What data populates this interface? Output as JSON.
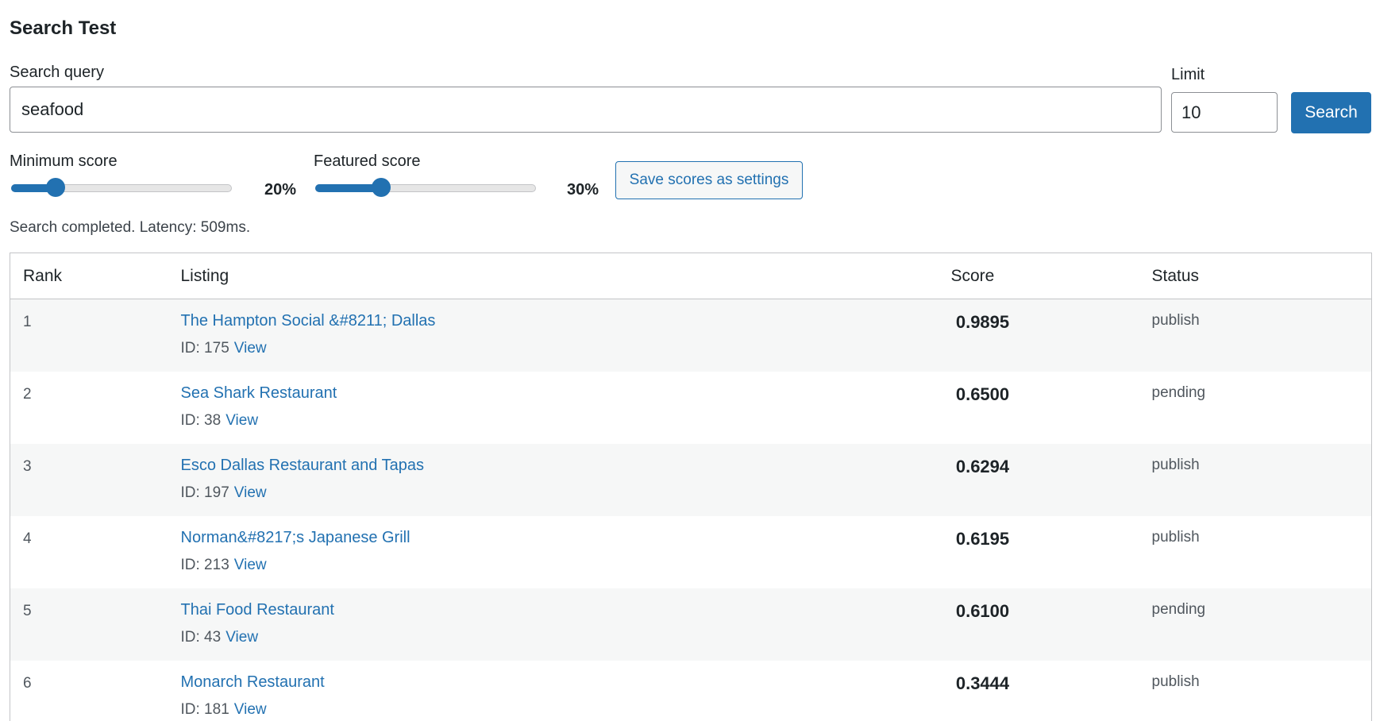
{
  "page": {
    "title": "Search Test"
  },
  "query": {
    "label": "Search query",
    "value": "seafood"
  },
  "limit": {
    "label": "Limit",
    "value": "10"
  },
  "search_button": {
    "label": "Search"
  },
  "min_score": {
    "label": "Minimum score",
    "value_text": "20%",
    "value": 20
  },
  "featured_score": {
    "label": "Featured score",
    "value_text": "30%",
    "value": 30
  },
  "save_button": {
    "label": "Save scores as settings"
  },
  "status": {
    "text": "Search completed. Latency: 509ms."
  },
  "table": {
    "headers": {
      "rank": "Rank",
      "listing": "Listing",
      "score": "Score",
      "status": "Status"
    },
    "rows": [
      {
        "rank": "1",
        "title": "The Hampton Social &#8211; Dallas",
        "id_text": "ID: 175",
        "view": "View",
        "score": "0.9895",
        "status": "publish"
      },
      {
        "rank": "2",
        "title": "Sea Shark Restaurant",
        "id_text": "ID: 38",
        "view": "View",
        "score": "0.6500",
        "status": "pending"
      },
      {
        "rank": "3",
        "title": "Esco Dallas Restaurant and Tapas",
        "id_text": "ID: 197",
        "view": "View",
        "score": "0.6294",
        "status": "publish"
      },
      {
        "rank": "4",
        "title": "Norman&#8217;s Japanese Grill",
        "id_text": "ID: 213",
        "view": "View",
        "score": "0.6195",
        "status": "publish"
      },
      {
        "rank": "5",
        "title": "Thai Food Restaurant",
        "id_text": "ID: 43",
        "view": "View",
        "score": "0.6100",
        "status": "pending"
      },
      {
        "rank": "6",
        "title": "Monarch Restaurant",
        "id_text": "ID: 181",
        "view": "View",
        "score": "0.3444",
        "status": "publish"
      }
    ]
  },
  "colors": {
    "accent": "#2271b1",
    "text": "#1d2327",
    "muted": "#50575e",
    "row_alt": "#f6f7f7"
  }
}
